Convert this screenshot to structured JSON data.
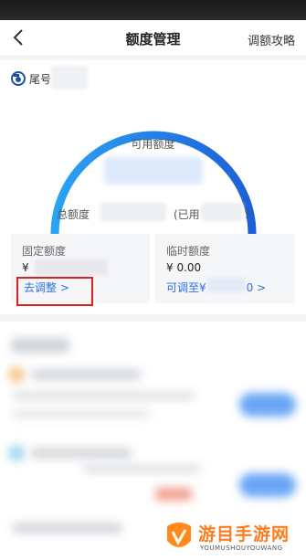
{
  "navbar": {
    "title": "额度管理",
    "right_action": "调额攻略"
  },
  "card": {
    "tail_label": "尾号",
    "available_label": "可用额度",
    "total_label": "总额度",
    "used_open": "(已用",
    "used_close": ")"
  },
  "fixed_quota": {
    "title": "固定额度",
    "currency": "¥",
    "adjust_link": "去调整 >"
  },
  "temp_quota": {
    "title": "临时额度",
    "value": "¥ 0.00",
    "link_prefix": "可调至¥",
    "link_suffix": "0 >"
  },
  "watermark": {
    "text_cn": "游目手游网",
    "text_en": "YOUMUSHOUYOUWANG"
  },
  "colors": {
    "accent_blue": "#2f6fe8",
    "gauge_start": "#2aa3f5",
    "gauge_end": "#1e5fd6",
    "highlight_red": "#e02020"
  }
}
